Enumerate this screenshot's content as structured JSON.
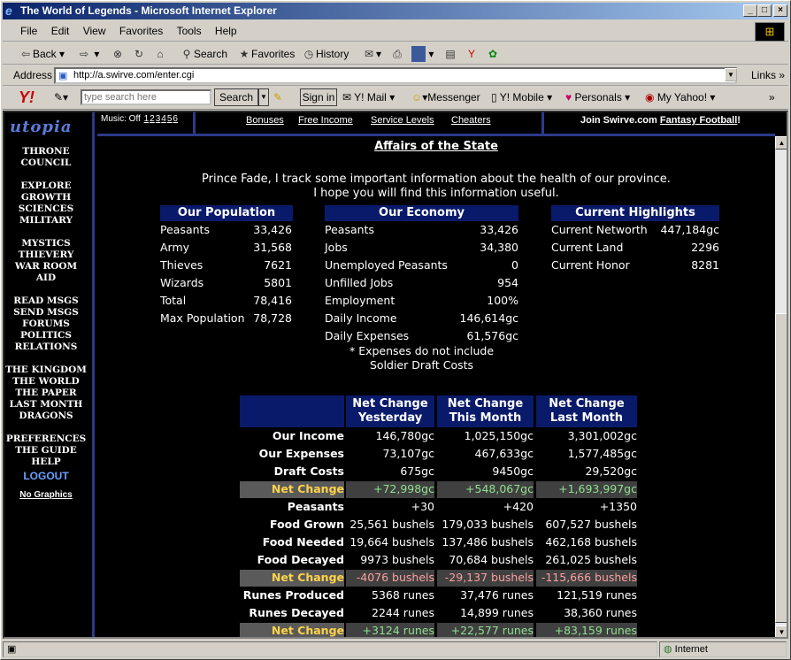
{
  "window": {
    "title": "The World of Legends - Microsoft Internet Explorer"
  },
  "menu": [
    "File",
    "Edit",
    "View",
    "Favorites",
    "Tools",
    "Help"
  ],
  "toolbar": {
    "back": "Back",
    "search": "Search",
    "favorites": "Favorites",
    "history": "History"
  },
  "address": {
    "label": "Address",
    "url": "http://a.swirve.com/enter.cgi",
    "links": "Links"
  },
  "yahoo": {
    "placeholder": "type search here",
    "search": "Search",
    "signin": "Sign in",
    "mail": "Y! Mail",
    "messenger": "Messenger",
    "mobile": "Y! Mobile",
    "personals": "Personals",
    "myyahoo": "My Yahoo!"
  },
  "nav": {
    "logo": "utopia",
    "throne": "THRONE",
    "council": "COUNCIL",
    "explore": "EXPLORE",
    "growth": "GROWTH",
    "sciences": "SCIENCES",
    "military": "MILITARY",
    "mystics": "MYSTICS",
    "thievery": "THIEVERY",
    "warroom": "WAR ROOM",
    "aid": "AID",
    "readmsgs": "READ MSGS",
    "sendmsgs": "SEND MSGS",
    "forums": "FORUMS",
    "politics": "POLITICS",
    "relations": "RELATIONS",
    "kingdom": "THE KINGDOM",
    "world": "THE WORLD",
    "paper": "THE PAPER",
    "lastmonth": "LAST MONTH",
    "dragons": "DRAGONS",
    "preferences": "PREFERENCES",
    "guide": "THE GUIDE",
    "help": "HELP",
    "logout": "LOGOUT",
    "nographics": "No Graphics"
  },
  "topstrip": {
    "music": "Music: Off",
    "music_nums": [
      "1",
      "2",
      "3",
      "4",
      "5",
      "6"
    ],
    "bonuses": "Bonuses",
    "free_income": "Free Income",
    "service_levels": "Service Levels",
    "cheaters": "Cheaters",
    "join": "Join Swirve.com",
    "fantasy": "Fantasy Football",
    "bang": "!"
  },
  "page": {
    "heading": "Affairs of the State",
    "intro1": "Prince Fade, I track some important information about the health of our province.",
    "intro2": "I hope you will find this information useful."
  },
  "population": {
    "title": "Our Population",
    "rows": [
      [
        "Peasants",
        "33,426"
      ],
      [
        "Army",
        "31,568"
      ],
      [
        "Thieves",
        "7621"
      ],
      [
        "Wizards",
        "5801"
      ],
      [
        "Total",
        "78,416"
      ],
      [
        "Max Population",
        "78,728"
      ]
    ]
  },
  "economy": {
    "title": "Our Economy",
    "rows": [
      [
        "Peasants",
        "33,426"
      ],
      [
        "Jobs",
        "34,380"
      ],
      [
        "Unemployed Peasants",
        "0"
      ],
      [
        "Unfilled Jobs",
        "954"
      ],
      [
        "Employment",
        "100%"
      ],
      [
        "Daily Income",
        "146,614gc"
      ],
      [
        "Daily Expenses",
        "61,576gc"
      ]
    ],
    "note1": "* Expenses do not include",
    "note2": "Soldier Draft Costs"
  },
  "highlights": {
    "title": "Current Highlights",
    "rows": [
      [
        "Current Networth",
        "447,184gc"
      ],
      [
        "Current Land",
        "2296"
      ],
      [
        "Current Honor",
        "8281"
      ]
    ]
  },
  "changes": {
    "headers": [
      [
        "Net Change",
        "Yesterday"
      ],
      [
        "Net Change",
        "This Month"
      ],
      [
        "Net Change",
        "Last Month"
      ]
    ],
    "rows": [
      {
        "label": "Our Income",
        "v": [
          "146,780gc",
          "1,025,150gc",
          "3,301,002gc"
        ]
      },
      {
        "label": "Our Expenses",
        "v": [
          "73,107gc",
          "467,633gc",
          "1,577,485gc"
        ]
      },
      {
        "label": "Draft Costs",
        "v": [
          "675gc",
          "9450gc",
          "29,520gc"
        ]
      },
      {
        "label": "Net Change",
        "v": [
          "+72,998gc",
          "+548,067gc",
          "+1,693,997gc"
        ]
      },
      {
        "label": "Peasants",
        "v": [
          "+30",
          "+420",
          "+1350"
        ]
      },
      {
        "label": "Food Grown",
        "v": [
          "25,561 bushels",
          "179,033 bushels",
          "607,527 bushels"
        ]
      },
      {
        "label": "Food Needed",
        "v": [
          "19,664 bushels",
          "137,486 bushels",
          "462,168 bushels"
        ]
      },
      {
        "label": "Food Decayed",
        "v": [
          "9973 bushels",
          "70,684 bushels",
          "261,025 bushels"
        ]
      },
      {
        "label": "Net Change",
        "v": [
          "-4076 bushels",
          "-29,137 bushels",
          "-115,666 bushels"
        ]
      },
      {
        "label": "Runes Produced",
        "v": [
          "5368 runes",
          "37,476 runes",
          "121,519 runes"
        ]
      },
      {
        "label": "Runes Decayed",
        "v": [
          "2244 runes",
          "14,899 runes",
          "38,360 runes"
        ]
      },
      {
        "label": "Net Change",
        "v": [
          "+3124 runes",
          "+22,577 runes",
          "+83,159 runes"
        ]
      }
    ]
  },
  "status": {
    "zone": "Internet"
  }
}
